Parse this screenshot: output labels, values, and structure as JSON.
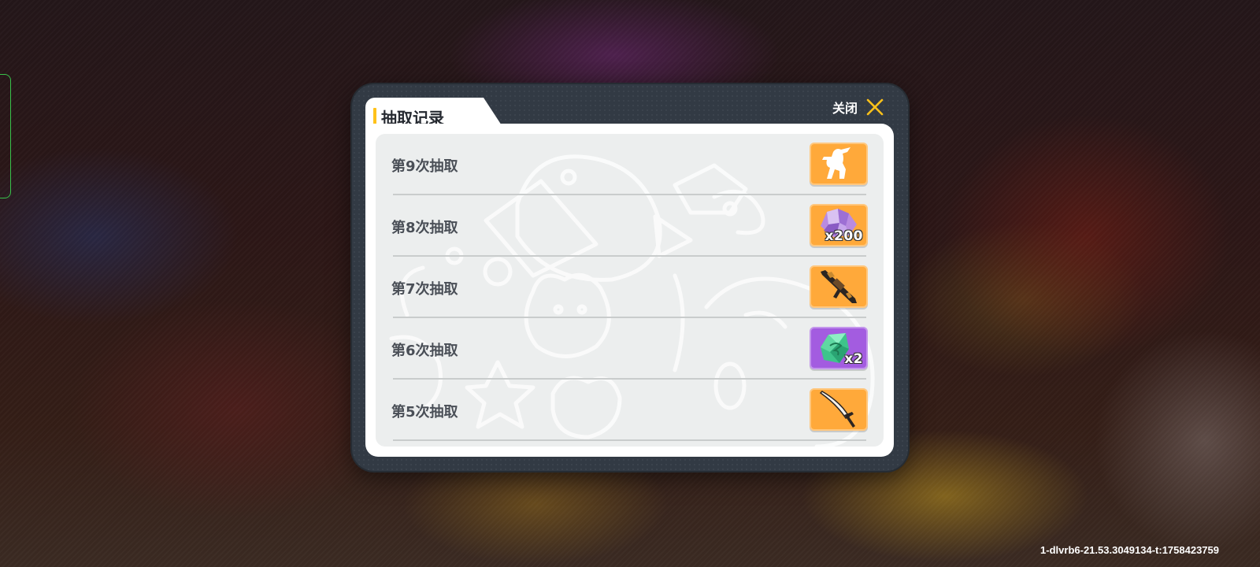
{
  "colors": {
    "title_accent": "#ffc21a",
    "close_icon": "#ffc21a",
    "item_gold": "#ffa93a",
    "item_purple": "#a35ce0",
    "dialog_frame": "#323a44"
  },
  "dialog": {
    "title": "抽取记录",
    "close_label": "关闭",
    "close_icon": "close-x-icon"
  },
  "records": [
    {
      "label": "第9次抽取",
      "item_icon": "character-silhouette-icon",
      "rarity": "gold",
      "quantity": ""
    },
    {
      "label": "第8次抽取",
      "item_icon": "purple-crystal-icon",
      "rarity": "gold",
      "quantity": "x200"
    },
    {
      "label": "第7次抽取",
      "item_icon": "rifle-icon",
      "rarity": "gold",
      "quantity": ""
    },
    {
      "label": "第6次抽取",
      "item_icon": "green-gem-icon",
      "rarity": "purple",
      "quantity": "x2"
    },
    {
      "label": "第5次抽取",
      "item_icon": "sword-icon",
      "rarity": "gold",
      "quantity": ""
    }
  ],
  "watermark": "1-dlvrb6-21.53.3049134-t:1758423759"
}
